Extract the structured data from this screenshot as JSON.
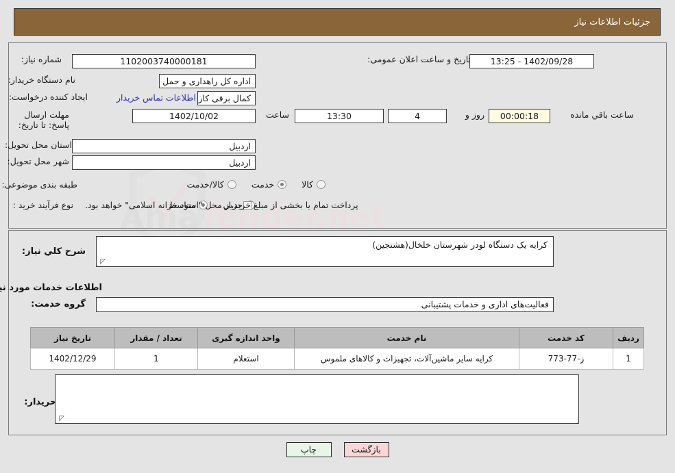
{
  "header": {
    "title": "جزئیات اطلاعات نیاز"
  },
  "watermark": {
    "text_left": "Ahia",
    "text_right": "Tender.net"
  },
  "form": {
    "need_number": {
      "label": "شماره نیاز:",
      "value": "1102003740000181"
    },
    "announce_datetime": {
      "label": "تاریخ و ساعت اعلان عمومی:",
      "value": "1402/09/28 - 13:25"
    },
    "buyer_org": {
      "label": "نام دستگاه خریدار:",
      "value": "اداره کل راهداری و حمل و نقل جاده ای استان اردبیل"
    },
    "request_creator": {
      "label": "ایجاد کننده درخواست:",
      "value": "کمال برقی کاربرداز اداره کل راهداری و حمل و نقل جاده ای استان اردبیل"
    },
    "contact_link": "اطلاعات تماس خریدار",
    "deadline": {
      "label": "مهلت ارسال پاسخ: تا تاریخ:",
      "date": "1402/10/02",
      "time_label": "ساعت",
      "time": "13:30",
      "days": "4",
      "days_label": "روز و",
      "remaining": "00:00:18",
      "remaining_label": "ساعت باقي مانده"
    },
    "delivery_province": {
      "label": "استان محل تحویل:",
      "value": "اردبیل"
    },
    "delivery_city": {
      "label": "شهر محل تحویل:",
      "value": "اردبیل"
    },
    "subject_category": {
      "label": "طبقه بندی موضوعی:",
      "options": [
        "کالا",
        "خدمت",
        "کالا/خدمت"
      ],
      "selected": "خدمت"
    },
    "purchase_type": {
      "label": "نوع فرآیند خرید :",
      "options": [
        "جزیي",
        "متوسط"
      ],
      "selected": "متوسط",
      "checkbox_text": "پرداخت تمام یا بخشی از مبلغ خرید،از محل \"اسناد خزانه اسلامی\" خواهد بود.",
      "checkbox_checked": false
    }
  },
  "need_description": {
    "label": "شرح کلي نیاز:",
    "value": "کرایه یک دستگاه لودر  شهرستان خلخال(هشتجین)"
  },
  "services_section": {
    "heading": "اطلاعات خدمات مورد نیاز",
    "service_group": {
      "label": "گروه خدمت:",
      "value": "فعالیت‌های اداری و خدمات پشتیبانی"
    }
  },
  "table": {
    "columns": [
      "ردیف",
      "کد خدمت",
      "نام خدمت",
      "واحد اندازه گیری",
      "تعداد / مقدار",
      "تاریخ نیاز"
    ],
    "rows": [
      {
        "row_no": "1",
        "service_code": "ز-77-773",
        "service_name": "کرایه سایر ماشین‌آلات، تجهیزات و کالاهای ملموس",
        "unit": "استعلام",
        "quantity": "1",
        "need_date": "1402/12/29"
      }
    ]
  },
  "buyer_notes": {
    "label": "توضیحات خریدار:",
    "value": ""
  },
  "buttons": {
    "print": "چاپ",
    "back": "بازگشت"
  },
  "colors": {
    "titlebar": "#8a6539",
    "table_header": "#bdbdbd",
    "link": "#2f2fb5",
    "print_btn": "#e7f6e7",
    "back_btn": "#fbd6d6",
    "page_bg": "#e4e4e4",
    "countdown_bg": "#fdfce2"
  }
}
